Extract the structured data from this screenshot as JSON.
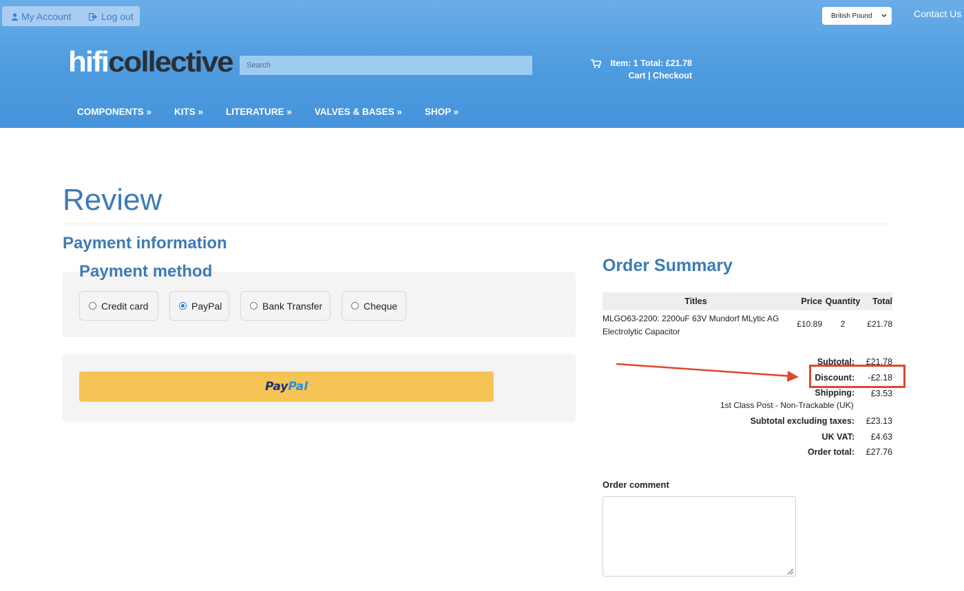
{
  "topbar": {
    "my_account": "My Account",
    "log_out": "Log out",
    "currency": "British Pound",
    "contact": "Contact Us"
  },
  "header": {
    "logo_part1": "hifi",
    "logo_part2": "collective",
    "search_placeholder": "Search",
    "cart_summary": "Item: 1 Total: £21.78",
    "cart_link": "Cart",
    "cart_separator": " | ",
    "checkout_link": "Checkout"
  },
  "nav": {
    "items": [
      {
        "label": "COMPONENTS »"
      },
      {
        "label": "KITS »"
      },
      {
        "label": "LITERATURE »"
      },
      {
        "label": "VALVES & BASES »"
      },
      {
        "label": "SHOP »"
      }
    ]
  },
  "page": {
    "title": "Review",
    "payment_info": "Payment information",
    "payment_method": "Payment method",
    "options": [
      {
        "label": "Credit card",
        "selected": false
      },
      {
        "label": "PayPal",
        "selected": true
      },
      {
        "label": "Bank Transfer",
        "selected": false
      },
      {
        "label": "Cheque",
        "selected": false
      }
    ],
    "paypal_button_part1": "Pay",
    "paypal_button_part2": "Pal"
  },
  "order_summary": {
    "title": "Order Summary",
    "columns": [
      "Titles",
      "Price",
      "Quantity",
      "Total"
    ],
    "rows": [
      {
        "title": "MLGO63-2200: 2200uF 63V Mundorf MLytic AG Electrolytic Capacitor",
        "price": "£10.89",
        "quantity": "2",
        "total": "£21.78"
      }
    ],
    "totals": {
      "subtotal_label": "Subtotal:",
      "subtotal": "£21.78",
      "discount_label": "Discount:",
      "discount": "-£2.18",
      "shipping_label": "Shipping:",
      "shipping": "£3.53",
      "shipping_method": "1st Class Post - Non-Trackable (UK)",
      "subtotal_ex_label": "Subtotal excluding taxes:",
      "subtotal_ex": "£23.13",
      "vat_label": "UK VAT:",
      "vat": "£4.63",
      "order_total_label": "Order total:",
      "order_total": "£27.76"
    },
    "comment_label": "Order comment"
  },
  "colors": {
    "header_blue": "#509ce0",
    "heading_blue": "#3c7bb5",
    "paypal_yellow": "#f6c456",
    "callout_red": "#e2452c"
  }
}
